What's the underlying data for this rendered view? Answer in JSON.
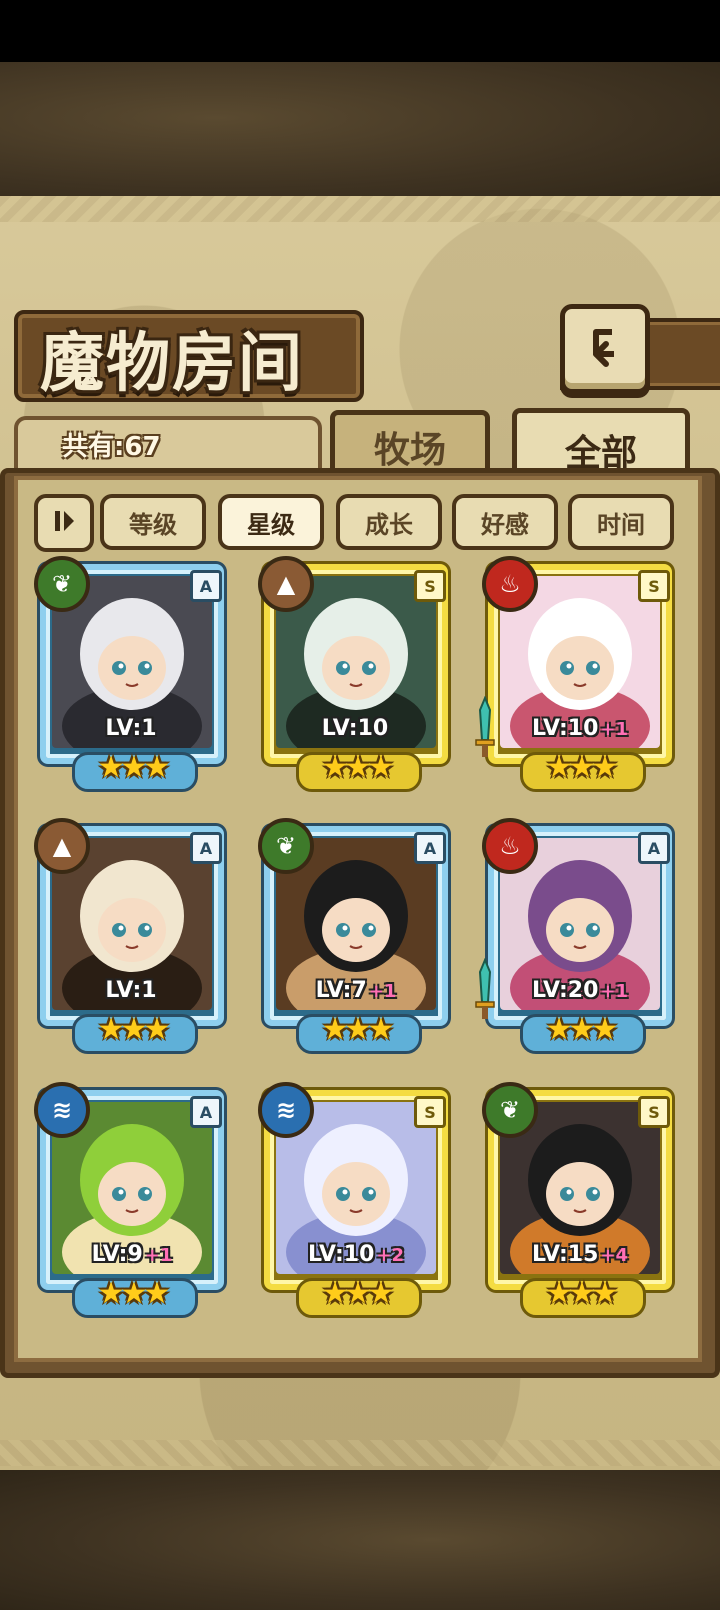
{
  "screen": {
    "title": "魔物房间",
    "count_label": "共有:67"
  },
  "tabs": [
    {
      "label": "牧场",
      "active": false
    },
    {
      "label": "全部",
      "active": true
    }
  ],
  "sort_options": [
    {
      "label": "等级",
      "active": false
    },
    {
      "label": "星级",
      "active": true
    },
    {
      "label": "成长",
      "active": false
    },
    {
      "label": "好感",
      "active": false
    },
    {
      "label": "时间",
      "active": false
    }
  ],
  "icons": {
    "back": "return-arrow-icon",
    "sort_toggle": "sort-direction-icon",
    "nature": "leaf-icon",
    "earth": "mountain-icon",
    "fire": "flame-icon",
    "water": "waves-icon"
  },
  "colors": {
    "rank_a_frame": "#8ecfee",
    "rank_s_frame": "#f4dc42",
    "star": "#ffcc1a",
    "level_bonus": "#ff6fb5",
    "element_nature": "#3e7a2a",
    "element_earth": "#8a5a34",
    "element_fire": "#c0281e",
    "element_water": "#2a6fb0"
  },
  "monsters": [
    {
      "element": "nature",
      "rank": "A",
      "level": "LV:1",
      "bonus": "",
      "stars": "★★★",
      "star_count": 3,
      "weapon": false
    },
    {
      "element": "earth",
      "rank": "S",
      "level": "LV:10",
      "bonus": "",
      "stars": "★★★",
      "star_count": 3,
      "weapon": false
    },
    {
      "element": "fire",
      "rank": "S",
      "level": "LV:10",
      "bonus": "+1",
      "stars": "★★★",
      "star_count": 3,
      "weapon": true
    },
    {
      "element": "earth",
      "rank": "A",
      "level": "LV:1",
      "bonus": "",
      "stars": "★★★",
      "star_count": 3,
      "weapon": false
    },
    {
      "element": "nature",
      "rank": "A",
      "level": "LV:7",
      "bonus": "+1",
      "stars": "★★★",
      "star_count": 3,
      "weapon": false
    },
    {
      "element": "fire",
      "rank": "A",
      "level": "LV:20",
      "bonus": "+1",
      "stars": "★★★",
      "star_count": 3,
      "weapon": true
    },
    {
      "element": "water",
      "rank": "A",
      "level": "LV:9",
      "bonus": "+1",
      "stars": "★★★",
      "star_count": 3,
      "weapon": false
    },
    {
      "element": "water",
      "rank": "S",
      "level": "LV:10",
      "bonus": "+2",
      "stars": "★★★",
      "star_count": 3,
      "weapon": false
    },
    {
      "element": "nature",
      "rank": "S",
      "level": "LV:15",
      "bonus": "+4",
      "stars": "★★★",
      "star_count": 3,
      "weapon": false
    }
  ]
}
